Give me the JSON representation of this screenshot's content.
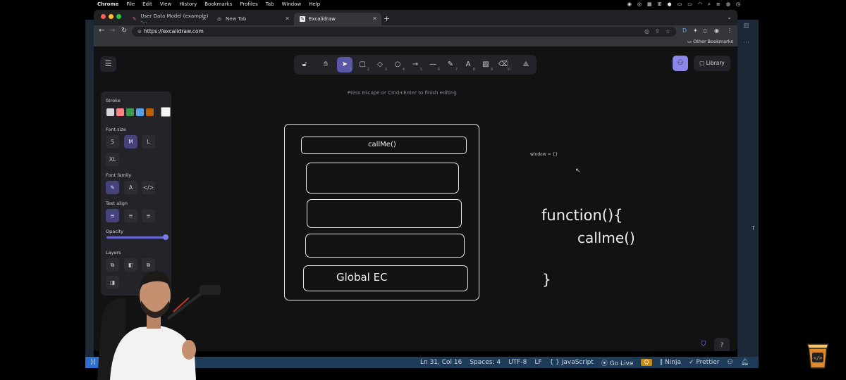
{
  "menubar": {
    "app": "Chrome",
    "items": [
      "File",
      "Edit",
      "View",
      "History",
      "Bookmarks",
      "Profiles",
      "Tab",
      "Window",
      "Help"
    ]
  },
  "browser": {
    "tabs": [
      {
        "favicon": "excalidraw-icon",
        "label": "User Data Model (example) -..."
      },
      {
        "favicon": "chrome-icon",
        "label": "New Tab"
      },
      {
        "favicon": "excalidraw-icon",
        "label": "Excalidraw"
      }
    ],
    "url": "https://excalidraw.com",
    "bookmarks_label": "Other Bookmarks"
  },
  "excalidraw": {
    "hint": "Press Escape or Cmd+Enter to finish editing",
    "library_label": "Library",
    "tools": [
      {
        "icon": "lock-icon",
        "key": ""
      },
      {
        "icon": "hand-icon",
        "key": ""
      },
      {
        "icon": "pointer-icon",
        "key": "1"
      },
      {
        "icon": "rectangle-icon",
        "key": "2"
      },
      {
        "icon": "diamond-icon",
        "key": "3"
      },
      {
        "icon": "ellipse-icon",
        "key": "4"
      },
      {
        "icon": "arrow-icon",
        "key": "5"
      },
      {
        "icon": "line-icon",
        "key": "6"
      },
      {
        "icon": "pencil-icon",
        "key": "7"
      },
      {
        "icon": "text-icon",
        "key": "8"
      },
      {
        "icon": "image-icon",
        "key": "9"
      },
      {
        "icon": "eraser-icon",
        "key": "0"
      },
      {
        "icon": "shapes-icon",
        "key": ""
      }
    ],
    "properties": {
      "stroke_label": "Stroke",
      "stroke_colors": [
        "#d9d9d9",
        "#ff8383",
        "#3a994c",
        "#56a2e8",
        "#b76100"
      ],
      "stroke_selected": "#f5f5f5",
      "font_size_label": "Font size",
      "font_sizes": [
        "S",
        "M",
        "L",
        "XL"
      ],
      "font_size_selected": "M",
      "font_family_label": "Font family",
      "text_align_label": "Text align",
      "opacity_label": "Opacity",
      "opacity": 1.0,
      "layers_label": "Layers"
    },
    "drawing": {
      "stack_top": "callMe()",
      "stack_bottom": "Global EC",
      "note": "window = {}",
      "code_line1": "function(){",
      "code_line2": "callme()",
      "code_line3": "}"
    }
  },
  "statusbar": {
    "position": "Ln 31, Col 16",
    "spaces": "Spaces: 4",
    "encoding": "UTF-8",
    "eol": "LF",
    "language": "{ } JavaScript",
    "golive": "Go Live",
    "ninja": "Ninja",
    "prettier": "Prettier"
  }
}
